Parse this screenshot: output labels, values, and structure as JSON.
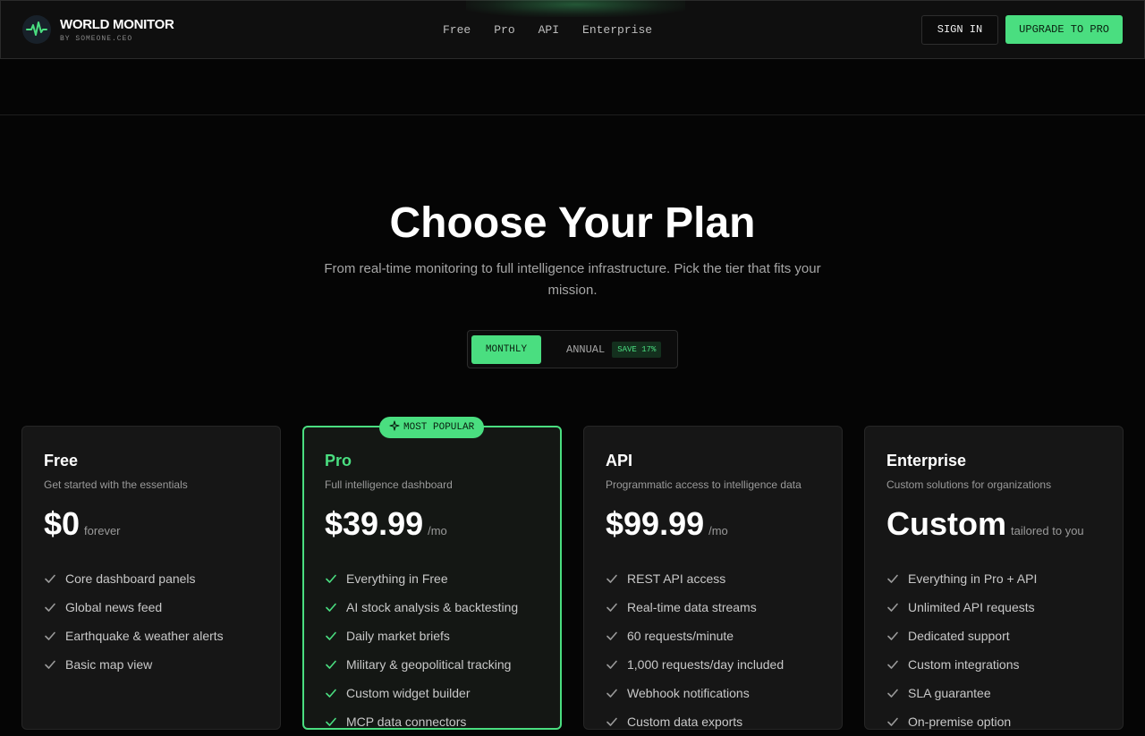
{
  "brand": {
    "name": "WORLD MONITOR",
    "sub": "BY SOMEONE.CEO"
  },
  "nav": [
    "Free",
    "Pro",
    "API",
    "Enterprise"
  ],
  "header_actions": {
    "signin": "SIGN IN",
    "upgrade": "UPGRADE TO PRO"
  },
  "hero": {
    "title": "Choose Your Plan",
    "subtitle": "From real-time monitoring to full intelligence infrastructure. Pick the tier that fits your mission."
  },
  "billing_toggle": {
    "monthly": "MONTHLY",
    "annual": "ANNUAL",
    "save": "SAVE 17%",
    "selected": "MONTHLY"
  },
  "colors": {
    "accent": "#4ade80",
    "background": "#050505",
    "card": "#161616"
  },
  "plans": [
    {
      "name": "Free",
      "description": "Get started with the essentials",
      "price": "$0",
      "period": "forever",
      "features": [
        "Core dashboard panels",
        "Global news feed",
        "Earthquake & weather alerts",
        "Basic map view"
      ]
    },
    {
      "name": "Pro",
      "badge": "MOST POPULAR",
      "description": "Full intelligence dashboard",
      "price": "$39.99",
      "period": "/mo",
      "features": [
        "Everything in Free",
        "AI stock analysis & backtesting",
        "Daily market briefs",
        "Military & geopolitical tracking",
        "Custom widget builder",
        "MCP data connectors"
      ]
    },
    {
      "name": "API",
      "description": "Programmatic access to intelligence data",
      "price": "$99.99",
      "period": "/mo",
      "features": [
        "REST API access",
        "Real-time data streams",
        "60 requests/minute",
        "1,000 requests/day included",
        "Webhook notifications",
        "Custom data exports"
      ]
    },
    {
      "name": "Enterprise",
      "description": "Custom solutions for organizations",
      "price": "Custom",
      "period": "tailored to you",
      "features": [
        "Everything in Pro + API",
        "Unlimited API requests",
        "Dedicated support",
        "Custom integrations",
        "SLA guarantee",
        "On-premise option"
      ]
    }
  ]
}
